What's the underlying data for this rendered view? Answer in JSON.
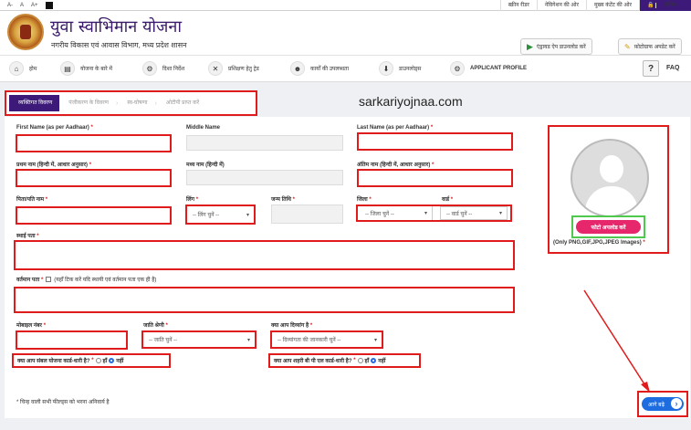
{
  "topbar": {
    "font_small": "A-",
    "font_normal": "A",
    "font_large": "A+",
    "links": [
      "स्क्रीन रीडर",
      "नेविगेशन की ओर",
      "मुख्य कंटेंट की ओर"
    ],
    "login": "लॉगिन"
  },
  "header": {
    "title": "युवा स्वाभिमान योजना",
    "subtitle": "नगरीय विकास एवं आवास विभाग, मध्य प्रदेश शासन",
    "android_btn": "एंड्रायड ऐप डाउनलोड करें",
    "photo_btn": "फ़ोटोग्राफ अपडेट करें"
  },
  "nav": {
    "items": [
      "होम",
      "योजना के बारे में",
      "दिशा निर्देश",
      "प्रशिक्षण हेतु ट्रेड",
      "कार्यों की उपलब्धता",
      "डाउनलोड्स",
      "APPLICANT PROFILE"
    ],
    "faq": "FAQ"
  },
  "steps": [
    "व्यक्तिगत विवरण",
    "पंजीकरण के विवरण",
    "स्व-घोषणा",
    "ओटीपी प्राप्त करें"
  ],
  "watermark": "sarkariyojnaa.com",
  "form": {
    "first_name": "First Name (as per Aadhaar)",
    "middle_name": "Middle Name",
    "last_name": "Last Name (as per Aadhaar)",
    "first_name_hi": "प्रथम नाम (हिन्दी में, आधार अनुसार)",
    "middle_name_hi": "मध्य नाम (हिन्दी में)",
    "last_name_hi": "अंतिम नाम (हिन्दी में, आधार अनुसार)",
    "father_name": "पिता/पति नाम",
    "gender": "लिंग",
    "gender_placeholder": "-- लिंग चुनें --",
    "dob": "जन्म तिथि",
    "district": "जिला",
    "district_placeholder": "-- जिला चुनें --",
    "ward": "वार्ड",
    "ward_placeholder": "-- वार्ड चुनें --",
    "permanent_address": "स्थाई पता",
    "current_address": "वर्तमान पता",
    "current_address_note": "(यहाँ टिक करें यदि स्थायी एवं वर्तमान पता एक ही है)",
    "mobile": "मोबाइल नंबर",
    "caste": "जाति श्रेणी",
    "caste_placeholder": "-- जाति चुनें --",
    "disabled": "क्या आप दिव्यांग है",
    "disabled_placeholder": "-- दिव्यांगता की जानकारी चुनें --",
    "sambal_q": "क्या आप संबल योजना कार्ड-धारी है?",
    "bpl_q": "क्या आप शहरी बी पी एल कार्ड-धारी है?",
    "yes": "हाँ",
    "no": "नहीं",
    "required_mark": "*",
    "note": "* चिन्ह वाली सभी फील्ड्स को भरना अनिवार्य है"
  },
  "photo": {
    "upload_btn": "फोटो अपलोड करें",
    "formats": "(Only PNG,GIF,JPG,JPEG Images)"
  },
  "next_btn": "आगे बढ़े",
  "colors": {
    "brand": "#3d1a7a",
    "highlight": "#e01b1b",
    "upload": "#e6276c",
    "next": "#1d6de0"
  }
}
